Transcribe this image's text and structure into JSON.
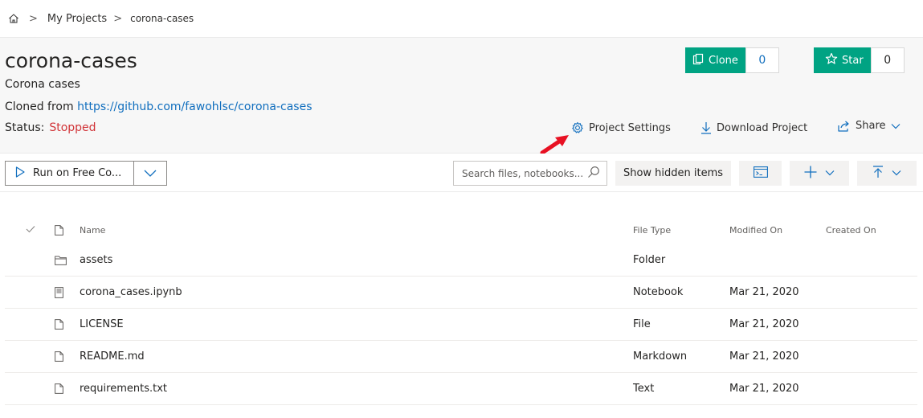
{
  "breadcrumb": {
    "home_icon": "home-icon",
    "separator": ">",
    "items": [
      "My Projects",
      "corona-cases"
    ]
  },
  "project": {
    "title": "corona-cases",
    "description": "Corona cases",
    "cloned_from_label": "Cloned from",
    "cloned_from_url": "https://github.com/fawohlsc/corona-cases",
    "status_label": "Status:",
    "status_value": "Stopped",
    "status_color": "#d13438"
  },
  "social": {
    "clone_label": "Clone",
    "clone_count": "0",
    "star_label": "Star",
    "star_count": "0",
    "accent": "#00a383"
  },
  "actions": {
    "settings": "Project Settings",
    "download": "Download Project",
    "share": "Share"
  },
  "toolbar": {
    "run_label": "Run on Free Co...",
    "search_placeholder": "Search files, notebooks...",
    "show_hidden": "Show hidden items"
  },
  "table": {
    "headers": {
      "name": "Name",
      "type": "File Type",
      "modified": "Modified On",
      "created": "Created On"
    },
    "rows": [
      {
        "icon": "folder-icon",
        "name": "assets",
        "type": "Folder",
        "modified": "",
        "created": ""
      },
      {
        "icon": "notebook-icon",
        "name": "corona_cases.ipynb",
        "type": "Notebook",
        "modified": "Mar 21, 2020",
        "created": ""
      },
      {
        "icon": "file-icon",
        "name": "LICENSE",
        "type": "File",
        "modified": "Mar 21, 2020",
        "created": ""
      },
      {
        "icon": "file-icon",
        "name": "README.md",
        "type": "Markdown",
        "modified": "Mar 21, 2020",
        "created": ""
      },
      {
        "icon": "file-icon",
        "name": "requirements.txt",
        "type": "Text",
        "modified": "Mar 21, 2020",
        "created": ""
      }
    ]
  }
}
